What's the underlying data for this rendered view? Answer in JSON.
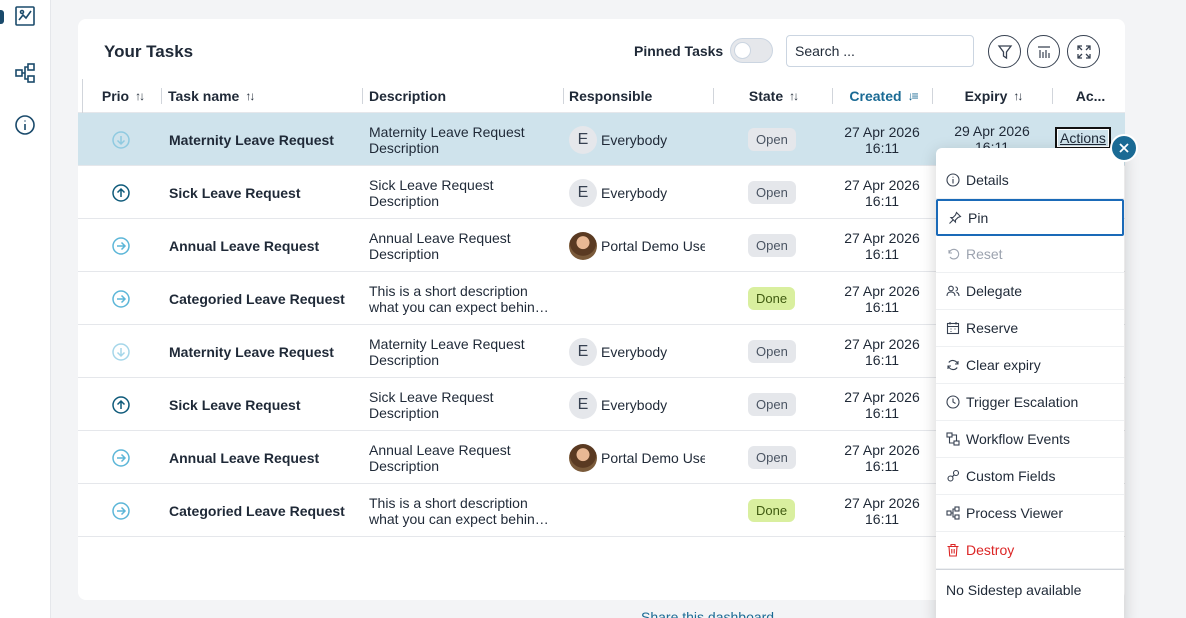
{
  "card": {
    "title": "Your Tasks",
    "pinned_label": "Pinned Tasks",
    "search_placeholder": "Search ..."
  },
  "columns": {
    "prio": "Prio",
    "task_name": "Task name",
    "description": "Description",
    "responsible": "Responsible",
    "state": "State",
    "created": "Created",
    "expiry": "Expiry",
    "actions": "Ac..."
  },
  "rows": [
    {
      "prio": "low",
      "name": "Maternity Leave Request",
      "desc1": "Maternity Leave Request",
      "desc2": "Description",
      "avatar": "E",
      "responsible": "Everybody",
      "state": "Open",
      "created1": "27 Apr 2026",
      "created2": "16:11",
      "expiry1": "29 Apr 2026",
      "expiry2": "16:11",
      "selected": true
    },
    {
      "prio": "high",
      "name": "Sick Leave Request",
      "desc1": "Sick Leave Request",
      "desc2": "Description",
      "avatar": "E",
      "responsible": "Everybody",
      "state": "Open",
      "created1": "27 Apr 2026",
      "created2": "16:11"
    },
    {
      "prio": "normal",
      "name": "Annual Leave Request",
      "desc1": "Annual Leave Request",
      "desc2": "Description",
      "avatar": "photo",
      "responsible": "Portal Demo User",
      "state": "Open",
      "created1": "27 Apr 2026",
      "created2": "16:11"
    },
    {
      "prio": "normal",
      "name": "Categoried Leave Request",
      "desc1": "This is a short description",
      "desc2": "what you can expect behin…",
      "avatar": "",
      "responsible": "",
      "state": "Done",
      "created1": "27 Apr 2026",
      "created2": "16:11"
    },
    {
      "prio": "low",
      "name": "Maternity Leave Request",
      "desc1": "Maternity Leave Request",
      "desc2": "Description",
      "avatar": "E",
      "responsible": "Everybody",
      "state": "Open",
      "created1": "27 Apr 2026",
      "created2": "16:11"
    },
    {
      "prio": "high",
      "name": "Sick Leave Request",
      "desc1": "Sick Leave Request",
      "desc2": "Description",
      "avatar": "E",
      "responsible": "Everybody",
      "state": "Open",
      "created1": "27 Apr 2026",
      "created2": "16:11"
    },
    {
      "prio": "normal",
      "name": "Annual Leave Request",
      "desc1": "Annual Leave Request",
      "desc2": "Description",
      "avatar": "photo",
      "responsible": "Portal Demo User",
      "state": "Open",
      "created1": "27 Apr 2026",
      "created2": "16:11"
    },
    {
      "prio": "normal",
      "name": "Categoried Leave Request",
      "desc1": "This is a short description",
      "desc2": "what you can expect behin…",
      "avatar": "",
      "responsible": "",
      "state": "Done",
      "created1": "27 Apr 2026",
      "created2": "16:11"
    }
  ],
  "actions_label": "Actions",
  "menu": {
    "items": [
      {
        "label": "Details",
        "icon": "info-icon"
      },
      {
        "label": "Pin",
        "icon": "pin-icon"
      },
      {
        "label": "Reset",
        "icon": "reset-icon"
      },
      {
        "label": "Delegate",
        "icon": "users-icon"
      },
      {
        "label": "Reserve",
        "icon": "calendar-icon"
      },
      {
        "label": "Clear expiry",
        "icon": "refresh-icon"
      },
      {
        "label": "Trigger Escalation",
        "icon": "clock-icon"
      },
      {
        "label": "Workflow Events",
        "icon": "workflow-icon"
      },
      {
        "label": "Custom Fields",
        "icon": "custom-fields-icon"
      },
      {
        "label": "Process Viewer",
        "icon": "process-icon"
      },
      {
        "label": "Destroy",
        "icon": "trash-icon"
      }
    ],
    "footer": "No Sidestep available"
  },
  "share_link": "Share this dashboard",
  "colors": {
    "accent": "#1a6a94",
    "selected_row": "#cfe3ec",
    "done_badge": "#d9ef9f",
    "danger": "#dc2626"
  }
}
